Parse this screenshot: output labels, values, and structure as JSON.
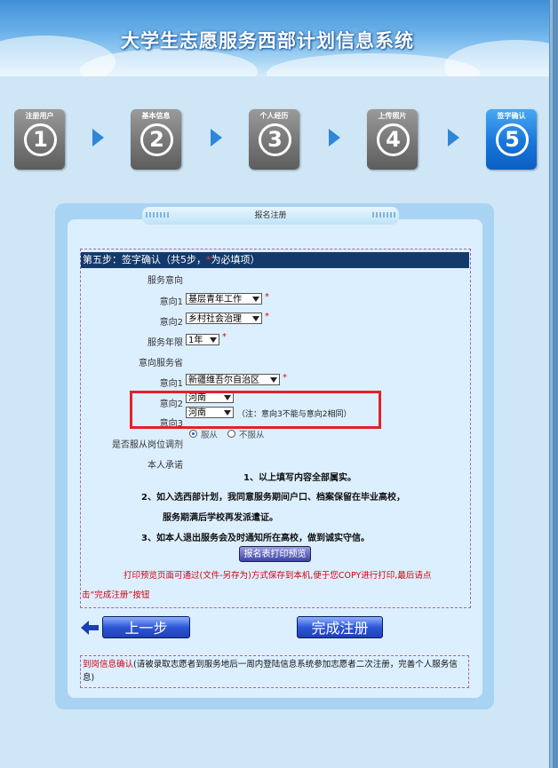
{
  "header": {
    "title": "大学生志愿服务西部计划信息系统"
  },
  "steps": [
    {
      "label": "注册用户",
      "number": "1",
      "active": false
    },
    {
      "label": "基本信息",
      "number": "2",
      "active": false
    },
    {
      "label": "个人经历",
      "number": "3",
      "active": false
    },
    {
      "label": "上传照片",
      "number": "4",
      "active": false
    },
    {
      "label": "签字确认",
      "number": "5",
      "active": true
    }
  ],
  "panel": {
    "tab_title": "报名注册"
  },
  "form": {
    "header_prefix": "第五步：签字确认（共5步，",
    "header_star": "*",
    "header_suffix": "为必填项）",
    "service_intent_label": "服务意向",
    "intent1_label": "意向1",
    "intent1_value": "基层青年工作",
    "intent2_label": "意向2",
    "intent2_value": "乡村社会治理",
    "years_label": "服务年限",
    "years_value": "1年",
    "province_label": "意向服务省",
    "province1_label": "意向1",
    "province1_value": "新疆维吾尔自治区",
    "province2_label": "意向2",
    "province2_value": "河南",
    "province3_label": "意向3",
    "province3_value": "河南",
    "province_note": "（注：意向3不能与意向2相同）",
    "required_star": "*",
    "adjust_label": "是否服从岗位调剂",
    "adjust_yes": "服从",
    "adjust_no": "不服从",
    "adjust_selected": "服从",
    "promise_label": "本人承诺",
    "promise_lines": [
      "1、以上填写内容全部属实。",
      "2、如入选西部计划，我同意服务期间户口、档案保留在毕业高校，",
      "服务期满后学校再发派遣证。",
      "3、如本人退出服务会及时通知所在高校，做到诚实守信。"
    ],
    "print_button": "报名表打印预览",
    "print_note_line1": "打印预览页面可通过(文件-另存为)方式保存到本机,便于您COPY进行打印,最后请点",
    "print_note_line2": "击“完成注册”按钮"
  },
  "nav": {
    "prev_button": "上一步",
    "finish_button": "完成注册"
  },
  "info": {
    "highlight": "到岗信息确认",
    "text": "(请被录取志愿者到服务地后一周内登陆信息系统参加志愿者二次注册，完善个人服务信息)"
  },
  "colors": {
    "header_bar": "#133a6b",
    "required": "#e00000",
    "highlight_box": "#e5202a",
    "note_red": "#d7000f",
    "active_step": "#1776dc",
    "inactive_step": "#777777"
  }
}
